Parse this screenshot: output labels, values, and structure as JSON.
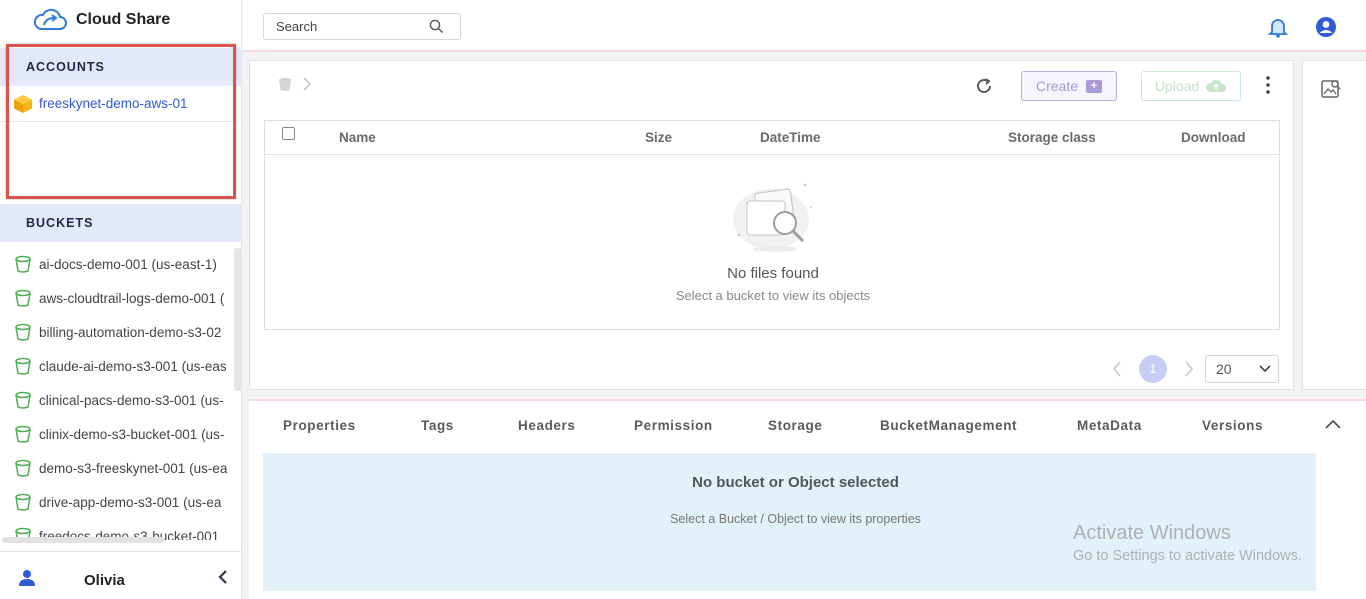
{
  "app": {
    "title": "Cloud Share"
  },
  "sidebar": {
    "accounts_header": "ACCOUNTS",
    "accounts": [
      {
        "label": "freeskynet-demo-aws-01",
        "icon": "aws-cube-icon"
      }
    ],
    "buckets_header": "BUCKETS",
    "buckets": [
      {
        "label": "ai-docs-demo-001 (us-east-1)"
      },
      {
        "label": "aws-cloudtrail-logs-demo-001 ("
      },
      {
        "label": "billing-automation-demo-s3-02"
      },
      {
        "label": "claude-ai-demo-s3-001 (us-eas"
      },
      {
        "label": "clinical-pacs-demo-s3-001 (us-"
      },
      {
        "label": "clinix-demo-s3-bucket-001 (us-"
      },
      {
        "label": "demo-s3-freeskynet-001 (us-ea"
      },
      {
        "label": "drive-app-demo-s3-001 (us-ea"
      },
      {
        "label": "freedocs-demo-s3-bucket-001"
      }
    ],
    "user": {
      "name": "Olivia"
    }
  },
  "topbar": {
    "search_placeholder": "Search"
  },
  "browser": {
    "create_label": "Create",
    "upload_label": "Upload",
    "columns": {
      "name": "Name",
      "size": "Size",
      "datetime": "DateTime",
      "storage_class": "Storage class",
      "download": "Download"
    },
    "empty_title": "No files found",
    "empty_subtitle": "Select a bucket to view its objects",
    "pagination": {
      "current_page": "1",
      "page_size": "20"
    }
  },
  "properties": {
    "tabs": [
      "Properties",
      "Tags",
      "Headers",
      "Permission",
      "Storage",
      "BucketManagement",
      "MetaData",
      "Versions"
    ],
    "empty_title": "No bucket or Object selected",
    "empty_subtitle": "Select a Bucket / Object to view its properties"
  },
  "watermark": {
    "line1": "Activate Windows",
    "line2": "Go to Settings to activate Windows."
  },
  "colors": {
    "accent": "#2f5cd6",
    "section_bg": "#e3e9fb",
    "highlight_border": "#d9534f",
    "bucket_icon": "#4caf50",
    "props_bg": "#e2f1fa"
  }
}
